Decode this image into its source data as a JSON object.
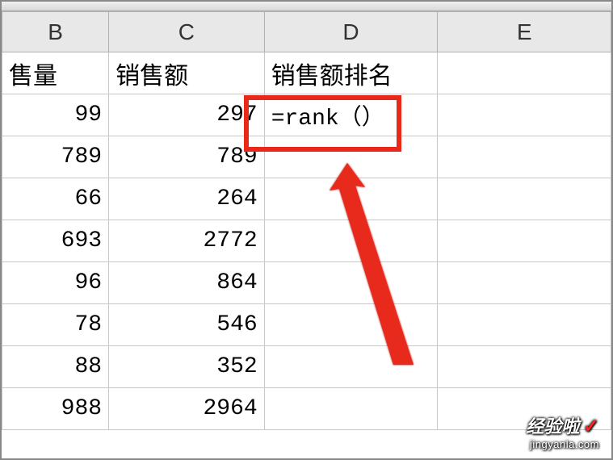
{
  "columns": {
    "B": "B",
    "C": "C",
    "D": "D",
    "E": "E"
  },
  "headers": {
    "B": "售量",
    "C": "销售额",
    "D": "销售额排名",
    "E": ""
  },
  "rows": [
    {
      "B": "99",
      "C": "297",
      "D": "=rank（）",
      "E": ""
    },
    {
      "B": "789",
      "C": "789",
      "D": "",
      "E": ""
    },
    {
      "B": "66",
      "C": "264",
      "D": "",
      "E": ""
    },
    {
      "B": "693",
      "C": "2772",
      "D": "",
      "E": ""
    },
    {
      "B": "96",
      "C": "864",
      "D": "",
      "E": ""
    },
    {
      "B": "78",
      "C": "546",
      "D": "",
      "E": ""
    },
    {
      "B": "88",
      "C": "352",
      "D": "",
      "E": ""
    },
    {
      "B": "988",
      "C": "2964",
      "D": "",
      "E": ""
    }
  ],
  "watermark": {
    "main": "经验啦",
    "check": "✓",
    "sub": "jingyanla.com"
  }
}
